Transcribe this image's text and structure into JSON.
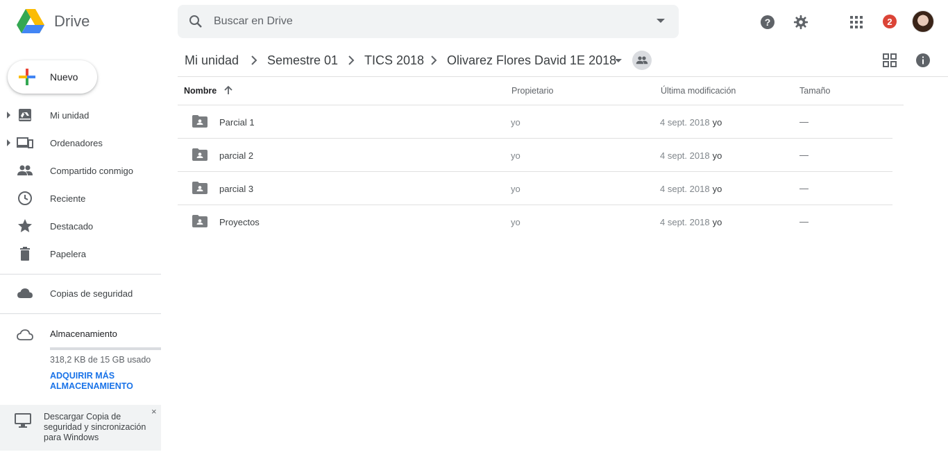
{
  "app": {
    "name": "Drive"
  },
  "search": {
    "placeholder": "Buscar en Drive"
  },
  "header": {
    "notification_count": "2"
  },
  "new_button": {
    "label": "Nuevo"
  },
  "sidebar": {
    "items": [
      {
        "label": "Mi unidad",
        "icon": "my-drive-icon",
        "expandable": true
      },
      {
        "label": "Ordenadores",
        "icon": "computers-icon",
        "expandable": true
      },
      {
        "label": "Compartido conmigo",
        "icon": "shared-people-icon",
        "expandable": false
      },
      {
        "label": "Reciente",
        "icon": "clock-icon",
        "expandable": false
      },
      {
        "label": "Destacado",
        "icon": "star-icon",
        "expandable": false
      },
      {
        "label": "Papelera",
        "icon": "trash-icon",
        "expandable": false
      }
    ],
    "backups": {
      "label": "Copias de seguridad",
      "icon": "cloud-icon"
    },
    "storage": {
      "label": "Almacenamiento",
      "icon": "cloud-outline-icon",
      "used_text": "318,2 KB de 15 GB usado",
      "used_fraction": 0.0,
      "buy_link": "ADQUIRIR MÁS ALMACENAMIENTO"
    },
    "promo": {
      "text": "Descargar Copia de seguridad y sincronización para Windows",
      "close": "×"
    }
  },
  "breadcrumb": [
    "Mi unidad",
    "Semestre 01",
    "TICS 2018",
    "Olivarez Flores David 1E 2018"
  ],
  "table": {
    "columns": {
      "name": "Nombre",
      "owner": "Propietario",
      "modified": "Última modificación",
      "size": "Tamaño"
    },
    "rows": [
      {
        "name": "Parcial 1",
        "owner": "yo",
        "date": "4 sept. 2018",
        "by": "yo",
        "size": "—"
      },
      {
        "name": "parcial 2",
        "owner": "yo",
        "date": "4 sept. 2018",
        "by": "yo",
        "size": "—"
      },
      {
        "name": "parcial 3",
        "owner": "yo",
        "date": "4 sept. 2018",
        "by": "yo",
        "size": "—"
      },
      {
        "name": "Proyectos",
        "owner": "yo",
        "date": "4 sept. 2018",
        "by": "yo",
        "size": "—"
      }
    ]
  },
  "colors": {
    "accent_blue": "#1a73e8",
    "badge_red": "#db4437",
    "drive_yellow": "#fbbc04",
    "drive_green": "#34a853",
    "drive_blue": "#4285f4"
  }
}
